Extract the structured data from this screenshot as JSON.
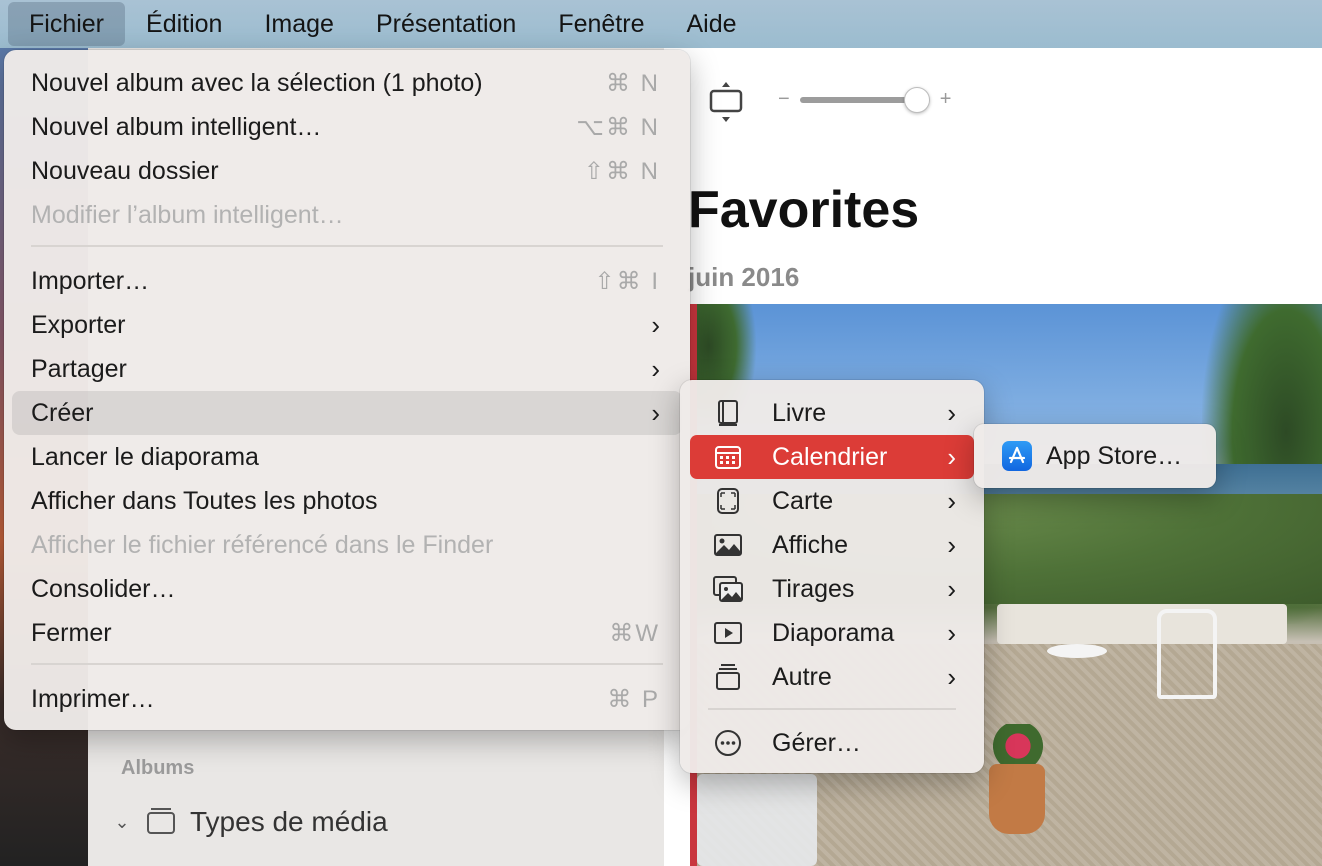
{
  "menubar": {
    "items": [
      "Fichier",
      "Édition",
      "Image",
      "Présentation",
      "Fenêtre",
      "Aide"
    ],
    "active": "Fichier"
  },
  "file_menu": {
    "items": [
      {
        "label": "Nouvel album avec la sélection (1 photo)",
        "shortcut": "⌘ N",
        "enabled": true
      },
      {
        "label": "Nouvel album intelligent…",
        "shortcut": "⌥⌘ N",
        "enabled": true
      },
      {
        "label": "Nouveau dossier",
        "shortcut": "⇧⌘ N",
        "enabled": true
      },
      {
        "label": "Modifier l’album intelligent…",
        "shortcut": "",
        "enabled": false
      },
      {
        "label": "Importer…",
        "shortcut": "⇧⌘ I",
        "enabled": true
      },
      {
        "label": "Exporter",
        "submenu": true,
        "enabled": true
      },
      {
        "label": "Partager",
        "submenu": true,
        "enabled": true
      },
      {
        "label": "Créer",
        "submenu": true,
        "enabled": true,
        "highlighted": true
      },
      {
        "label": "Lancer le diaporama",
        "shortcut": "",
        "enabled": true
      },
      {
        "label": "Afficher dans Toutes les photos",
        "shortcut": "",
        "enabled": true
      },
      {
        "label": "Afficher le fichier référencé dans le Finder",
        "shortcut": "",
        "enabled": false
      },
      {
        "label": "Consolider…",
        "shortcut": "",
        "enabled": true
      },
      {
        "label": "Fermer",
        "shortcut": "⌘W",
        "enabled": true
      },
      {
        "label": "Imprimer…",
        "shortcut": "⌘ P",
        "enabled": true
      }
    ]
  },
  "create_menu": {
    "items": [
      {
        "label": "Livre",
        "icon": "book-icon"
      },
      {
        "label": "Calendrier",
        "icon": "calendar-icon",
        "selected": true
      },
      {
        "label": "Carte",
        "icon": "card-icon"
      },
      {
        "label": "Affiche",
        "icon": "poster-icon"
      },
      {
        "label": "Tirages",
        "icon": "prints-icon"
      },
      {
        "label": "Diaporama",
        "icon": "slideshow-icon"
      },
      {
        "label": "Autre",
        "icon": "other-icon"
      },
      {
        "label": "Gérer…",
        "icon": "more-icon"
      }
    ]
  },
  "calendar_submenu": {
    "items": [
      {
        "label": "App Store…",
        "icon": "app-store-icon"
      }
    ]
  },
  "main": {
    "title": "Favorites",
    "date": "juin 2016",
    "zoom_minus": "−",
    "zoom_plus": "+",
    "zoom_level": 0.9
  },
  "sidebar": {
    "section_label": "Albums",
    "row_label": "Types de média"
  },
  "colors": {
    "accent": "#dc3c37",
    "menubar": "#a4c0d2"
  }
}
